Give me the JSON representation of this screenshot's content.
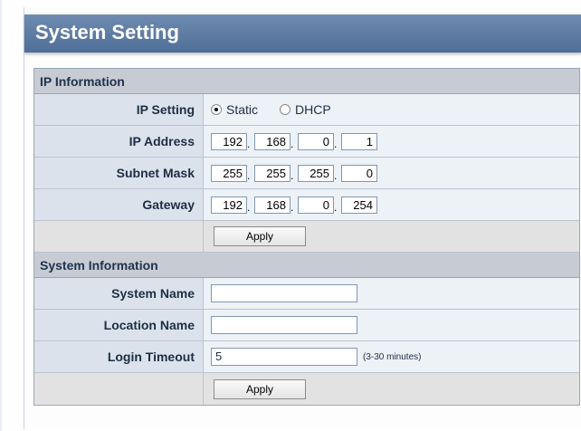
{
  "page": {
    "title": "System Setting"
  },
  "ip_info": {
    "header": "IP Information",
    "ip_setting": {
      "label": "IP Setting",
      "options": [
        {
          "label": "Static",
          "checked": true
        },
        {
          "label": "DHCP",
          "checked": false
        }
      ]
    },
    "ip_address": {
      "label": "IP Address",
      "octets": [
        "192",
        "168",
        "0",
        "1"
      ]
    },
    "subnet_mask": {
      "label": "Subnet Mask",
      "octets": [
        "255",
        "255",
        "255",
        "0"
      ]
    },
    "gateway": {
      "label": "Gateway",
      "octets": [
        "192",
        "168",
        "0",
        "254"
      ]
    },
    "apply_label": "Apply"
  },
  "system_info": {
    "header": "System Information",
    "system_name": {
      "label": "System Name",
      "value": ""
    },
    "location_name": {
      "label": "Location Name",
      "value": ""
    },
    "login_timeout": {
      "label": "Login Timeout",
      "value": "5",
      "hint": "(3-30 minutes)"
    },
    "apply_label": "Apply"
  }
}
